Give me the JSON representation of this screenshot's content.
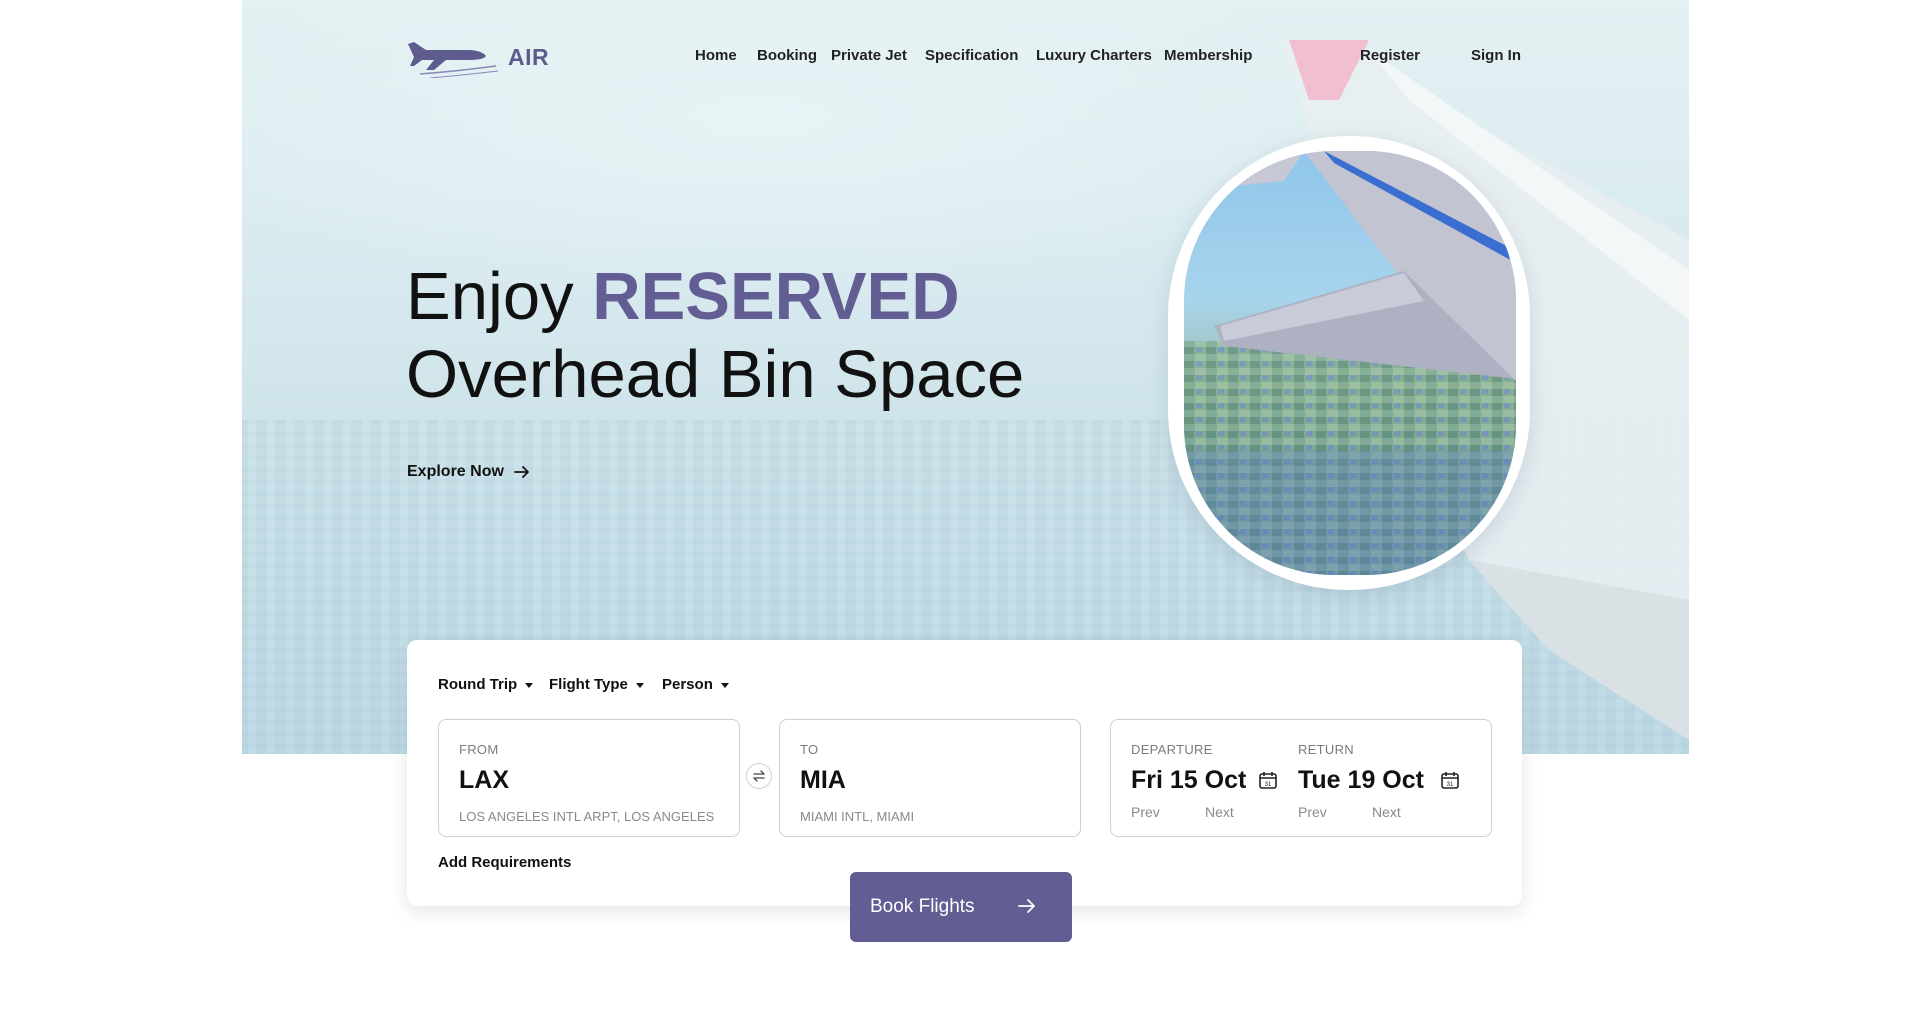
{
  "brand": {
    "name": "AIR",
    "accent_color": "#625d93"
  },
  "nav": {
    "items": [
      {
        "label": "Home"
      },
      {
        "label": "Booking"
      },
      {
        "label": "Private Jet"
      },
      {
        "label": "Specification"
      },
      {
        "label": "Luxury Charters"
      },
      {
        "label": "Membership"
      }
    ],
    "register": "Register",
    "sign_in": "Sign In"
  },
  "hero": {
    "headline_prefix": "Enjoy",
    "headline_accent": "RESERVED",
    "headline_line2": "Overhead Bin Space",
    "explore": "Explore Now"
  },
  "booking": {
    "options": [
      {
        "label": "Round Trip"
      },
      {
        "label": "Flight Type"
      },
      {
        "label": "Person"
      }
    ],
    "from": {
      "label": "FROM",
      "code": "LAX",
      "airport": "LOS ANGELES INTL ARPT, LOS ANGELES"
    },
    "to": {
      "label": "TO",
      "code": "MIA",
      "airport": "MIAMI INTL, MIAMI"
    },
    "departure": {
      "label": "DEPARTURE",
      "date": "Fri 15 Oct",
      "prev": "Prev",
      "next": "Next"
    },
    "return": {
      "label": "RETURN",
      "date": "Tue 19 Oct",
      "prev": "Prev",
      "next": "Next"
    },
    "add_requirements": "Add Requirements",
    "book_button": "Book Flights"
  },
  "icons": [
    "plane-logo-icon",
    "arrow-right-icon",
    "caret-down-icon",
    "swap-icon",
    "calendar-icon"
  ]
}
